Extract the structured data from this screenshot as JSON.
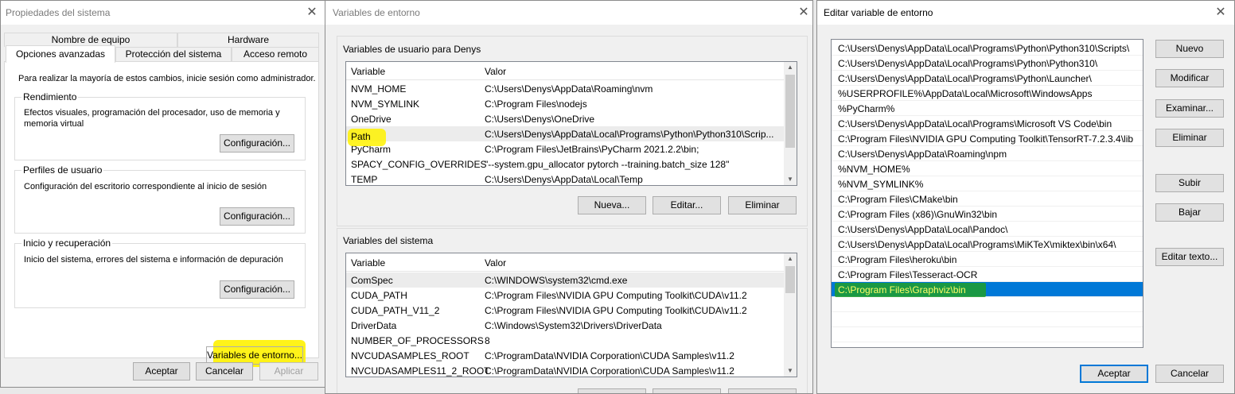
{
  "sys": {
    "title": "Propiedades del sistema",
    "tabs_top": [
      "Nombre de equipo",
      "Hardware"
    ],
    "tabs_bottom": [
      "Opciones avanzadas",
      "Protección del sistema",
      "Acceso remoto"
    ],
    "intro": "Para realizar la mayoría de estos cambios, inicie sesión como administrador.",
    "groups": [
      {
        "title": "Rendimiento",
        "text": "Efectos visuales, programación del procesador, uso de memoria y memoria virtual",
        "button": "Configuración..."
      },
      {
        "title": "Perfiles de usuario",
        "text": "Configuración del escritorio correspondiente al inicio de sesión",
        "button": "Configuración..."
      },
      {
        "title": "Inicio y recuperación",
        "text": "Inicio del sistema, errores del sistema e información de depuración",
        "button": "Configuración..."
      }
    ],
    "env_button": "Variables de entorno...",
    "ok": "Aceptar",
    "cancel": "Cancelar",
    "apply": "Aplicar"
  },
  "env": {
    "title": "Variables de entorno",
    "user_label": "Variables de usuario para Denys",
    "col_var": "Variable",
    "col_val": "Valor",
    "user_vars": [
      {
        "name": "NVM_HOME",
        "value": "C:\\Users\\Denys\\AppData\\Roaming\\nvm"
      },
      {
        "name": "NVM_SYMLINK",
        "value": "C:\\Program Files\\nodejs"
      },
      {
        "name": "OneDrive",
        "value": "C:\\Users\\Denys\\OneDrive"
      },
      {
        "name": "Path",
        "value": "C:\\Users\\Denys\\AppData\\Local\\Programs\\Python\\Python310\\Scrip..."
      },
      {
        "name": "PyCharm",
        "value": "C:\\Program Files\\JetBrains\\PyCharm 2021.2.2\\bin;"
      },
      {
        "name": "SPACY_CONFIG_OVERRIDES",
        "value": "\"--system.gpu_allocator pytorch --training.batch_size 128\""
      },
      {
        "name": "TEMP",
        "value": "C:\\Users\\Denys\\AppData\\Local\\Temp"
      }
    ],
    "user_buttons": {
      "new": "Nueva...",
      "edit": "Editar...",
      "delete": "Eliminar"
    },
    "sys_label": "Variables del sistema",
    "sys_vars": [
      {
        "name": "ComSpec",
        "value": "C:\\WINDOWS\\system32\\cmd.exe"
      },
      {
        "name": "CUDA_PATH",
        "value": "C:\\Program Files\\NVIDIA GPU Computing Toolkit\\CUDA\\v11.2"
      },
      {
        "name": "CUDA_PATH_V11_2",
        "value": "C:\\Program Files\\NVIDIA GPU Computing Toolkit\\CUDA\\v11.2"
      },
      {
        "name": "DriverData",
        "value": "C:\\Windows\\System32\\Drivers\\DriverData"
      },
      {
        "name": "NUMBER_OF_PROCESSORS",
        "value": "8"
      },
      {
        "name": "NVCUDASAMPLES_ROOT",
        "value": "C:\\ProgramData\\NVIDIA Corporation\\CUDA Samples\\v11.2"
      },
      {
        "name": "NVCUDASAMPLES11_2_ROOT",
        "value": "C:\\ProgramData\\NVIDIA Corporation\\CUDA Samples\\v11.2"
      }
    ]
  },
  "edit": {
    "title": "Editar variable de entorno",
    "paths": [
      "C:\\Users\\Denys\\AppData\\Local\\Programs\\Python\\Python310\\Scripts\\",
      "C:\\Users\\Denys\\AppData\\Local\\Programs\\Python\\Python310\\",
      "C:\\Users\\Denys\\AppData\\Local\\Programs\\Python\\Launcher\\",
      "%USERPROFILE%\\AppData\\Local\\Microsoft\\WindowsApps",
      "%PyCharm%",
      "C:\\Users\\Denys\\AppData\\Local\\Programs\\Microsoft VS Code\\bin",
      "C:\\Program Files\\NVIDIA GPU Computing Toolkit\\TensorRT-7.2.3.4\\lib",
      "C:\\Users\\Denys\\AppData\\Roaming\\npm",
      "%NVM_HOME%",
      "%NVM_SYMLINK%",
      "C:\\Program Files\\CMake\\bin",
      "C:\\Program Files (x86)\\GnuWin32\\bin",
      "C:\\Users\\Denys\\AppData\\Local\\Pandoc\\",
      "C:\\Users\\Denys\\AppData\\Local\\Programs\\MiKTeX\\miktex\\bin\\x64\\",
      "C:\\Program Files\\heroku\\bin",
      "C:\\Program Files\\Tesseract-OCR",
      "C:\\Program Files\\Graphviz\\bin"
    ],
    "selected_index": 16,
    "buttons": {
      "new": "Nuevo",
      "modify": "Modificar",
      "browse": "Examinar...",
      "delete": "Eliminar",
      "up": "Subir",
      "down": "Bajar",
      "edit_text": "Editar texto..."
    },
    "ok": "Aceptar",
    "cancel": "Cancelar"
  }
}
